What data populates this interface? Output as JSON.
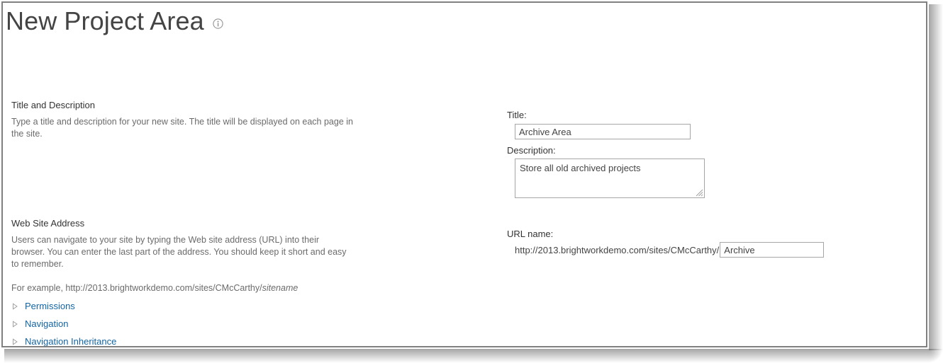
{
  "page": {
    "title": "New Project Area",
    "info_icon": "info-circle-icon"
  },
  "sections": [
    {
      "heading": "Title and Description",
      "body": "Type a title and description for your new site. The title will be displayed on each page in the site."
    },
    {
      "heading": "Web Site Address",
      "body": "Users can navigate to your site by typing the Web site address (URL) into their browser. You can enter the last part of the address. You should keep it short and easy to remember.",
      "example_prefix": "For example, http://2013.brightworkdemo.com/sites/CMcCarthy/",
      "example_italic": "sitename"
    }
  ],
  "collapsibles": [
    {
      "label": "Permissions",
      "icon": "chevron-right-icon"
    },
    {
      "label": "Navigation",
      "icon": "chevron-right-icon"
    },
    {
      "label": "Navigation Inheritance",
      "icon": "chevron-right-icon"
    }
  ],
  "form": {
    "title_label": "Title:",
    "title_value": "Archive Area",
    "description_label": "Description:",
    "description_value": "Store all old archived projects",
    "url_label": "URL name:",
    "url_prefix": "http://2013.brightworkdemo.com/sites/CMcCarthy/",
    "url_value": "Archive"
  },
  "colors": {
    "link": "#1264a3",
    "heading_text": "#333333",
    "body_text": "#6b6b6b",
    "frame_border": "#808080",
    "input_border": "#a6a6a6"
  }
}
